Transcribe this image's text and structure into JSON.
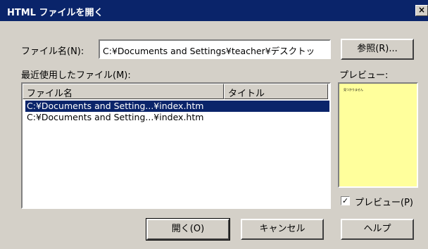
{
  "window": {
    "title": "HTML ファイルを開く",
    "close_symbol": "×"
  },
  "filename": {
    "label": "ファイル名(N):",
    "value": "C:¥Documents and Settings¥teacher¥デスクトッ",
    "browse_button": "参照(R)..."
  },
  "recent": {
    "label": "最近使用したファイル(M):",
    "columns": [
      "ファイル名",
      "タイトル"
    ],
    "rows": [
      {
        "file": "C:¥Documents and Setting...¥index.htm",
        "selected": true
      },
      {
        "file": "C:¥Documents and Setting...¥index.htm",
        "selected": false
      }
    ]
  },
  "preview": {
    "label": "プレビュー:",
    "mini_text": "見つかりません",
    "checkbox_label": "プレビュー(P)",
    "checkbox_checked": true,
    "checkbox_mark": "✓",
    "background_color": "#ffff9c"
  },
  "buttons": {
    "open": "開く(O)",
    "cancel": "キャンセル",
    "help": "ヘルプ"
  },
  "colors": {
    "titlebar": "#0a246a",
    "dialog_bg": "#d4d0c8",
    "selection": "#0a246a"
  },
  "icons": {
    "close": "close-icon",
    "checkmark": "checkmark-icon"
  }
}
